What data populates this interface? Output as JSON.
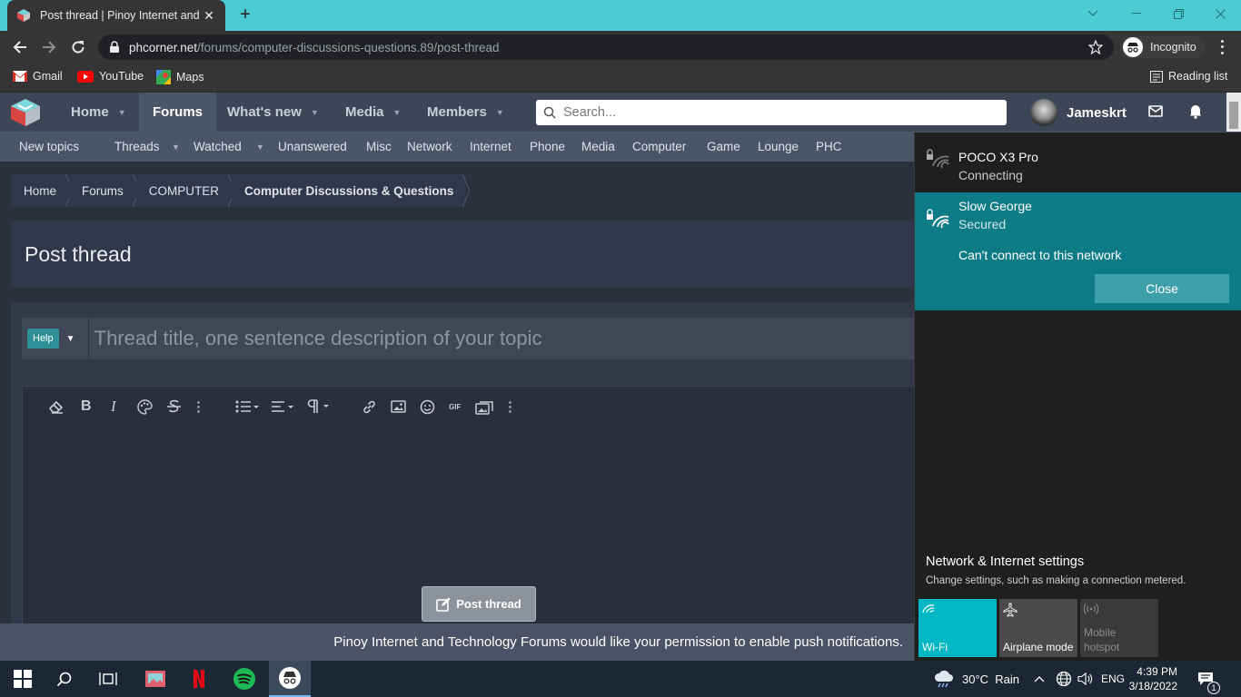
{
  "browser": {
    "tab_title": "Post thread | Pinoy Internet and Technology Forums",
    "url_host": "phcorner.net",
    "url_path": "/forums/computer-discussions-questions.89/post-thread",
    "incognito_label": "Incognito",
    "reading_list_label": "Reading list",
    "bookmarks": [
      "Gmail",
      "YouTube",
      "Maps"
    ]
  },
  "site": {
    "nav": {
      "home": "Home",
      "forums": "Forums",
      "whats_new": "What's new",
      "media": "Media",
      "members": "Members"
    },
    "search_placeholder": "Search...",
    "username": "Jameskrt",
    "subnav": [
      "New topics",
      "Threads",
      "Watched",
      "Unanswered",
      "Misc",
      "Network",
      "Internet",
      "Phone",
      "Media",
      "Computer",
      "Game",
      "Lounge",
      "PHC"
    ],
    "breadcrumbs": [
      "Home",
      "Forums",
      "COMPUTER",
      "Computer Discussions & Questions"
    ],
    "page_title": "Post thread",
    "help_label": "Help",
    "title_placeholder": "Thread title, one sentence description of your topic",
    "post_button": "Post thread",
    "push_notice": "Pinoy Internet and Technology Forums would like your permission to enable push notifications."
  },
  "network_flyout": {
    "networks": [
      {
        "name": "POCO X3 Pro",
        "status": "Connecting"
      },
      {
        "name": "Slow George",
        "status": "Secured",
        "message": "Can't connect to this network",
        "close_label": "Close"
      }
    ],
    "settings_title": "Network & Internet settings",
    "settings_desc": "Change settings, such as making a connection metered.",
    "tiles": {
      "wifi": "Wi-Fi",
      "airplane": "Airplane mode",
      "hotspot_line1": "Mobile",
      "hotspot_line2": "hotspot"
    }
  },
  "taskbar": {
    "weather": "30°C  Rain",
    "language": "ENG",
    "time": "4:39 PM",
    "date": "3/18/2022",
    "notification_count": "1"
  },
  "colors": {
    "accent_teal": "#0e7c86",
    "tabstrip": "#4ccbd2",
    "forum_nav": "#3d4657"
  }
}
